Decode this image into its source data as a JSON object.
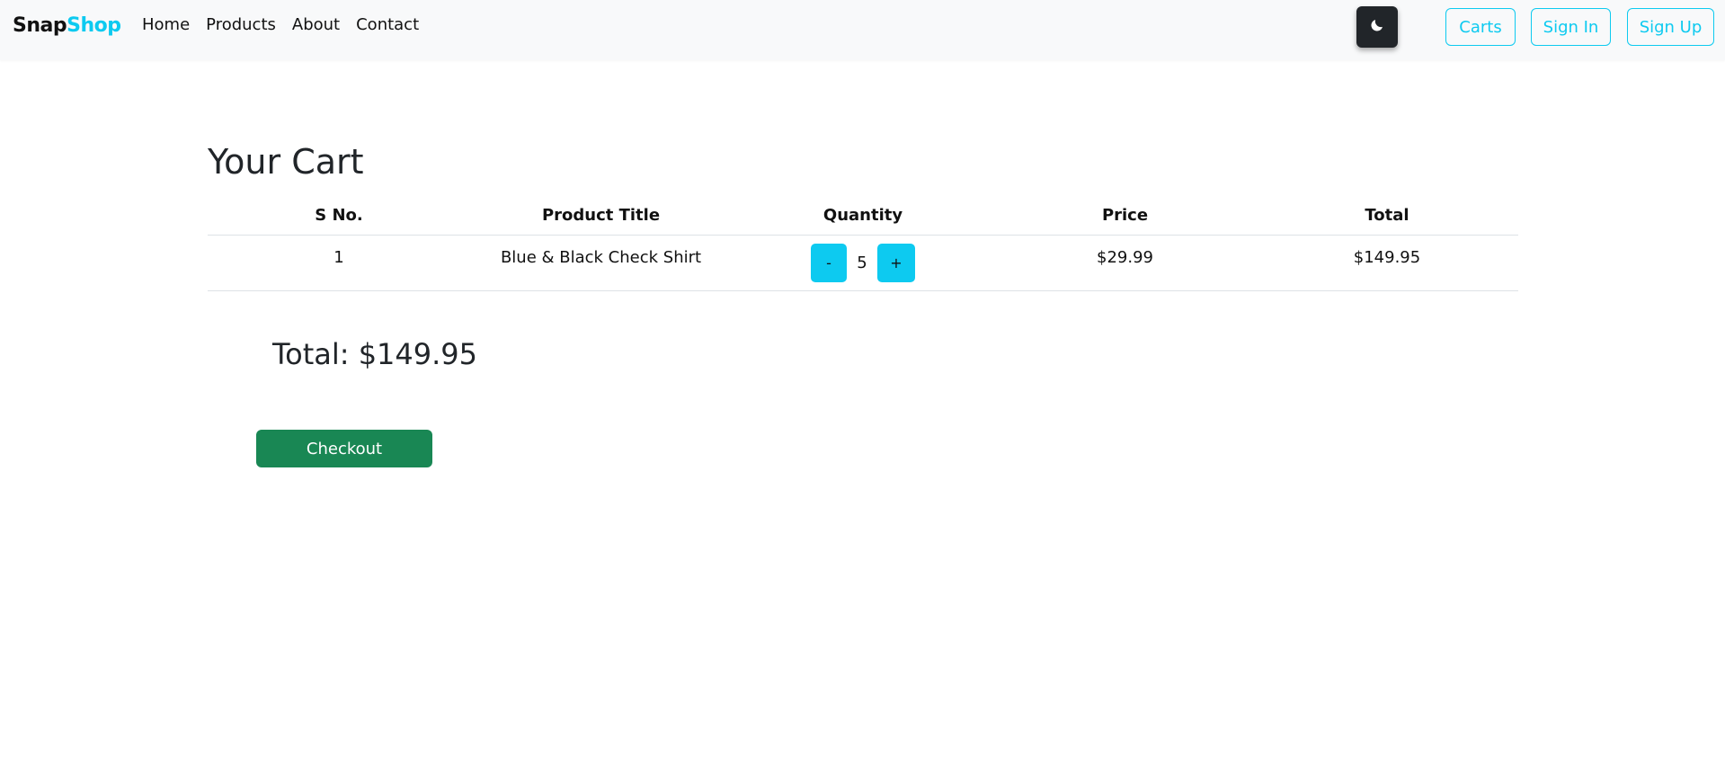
{
  "navbar": {
    "brand_part1": "Snap",
    "brand_part2": "Shop",
    "links": [
      "Home",
      "Products",
      "About",
      "Contact"
    ],
    "theme_toggle_icon": "moon-icon",
    "buttons": {
      "carts": "Carts",
      "sign_in": "Sign In",
      "sign_up": "Sign Up"
    }
  },
  "cart": {
    "title": "Your Cart",
    "columns": [
      "S No.",
      "Product Title",
      "Quantity",
      "Price",
      "Total"
    ],
    "rows": [
      {
        "sno": "1",
        "title": "Blue & Black Check Shirt",
        "decrement_label": "-",
        "quantity": "5",
        "increment_label": "+",
        "price": "$29.99",
        "total": "$149.95"
      }
    ],
    "grand_total": "Total: $149.95",
    "checkout_label": "Checkout"
  },
  "colors": {
    "accent": "#0dcaf0",
    "success": "#198754",
    "dark": "#212529",
    "navbar_bg": "#f8f9fa"
  }
}
